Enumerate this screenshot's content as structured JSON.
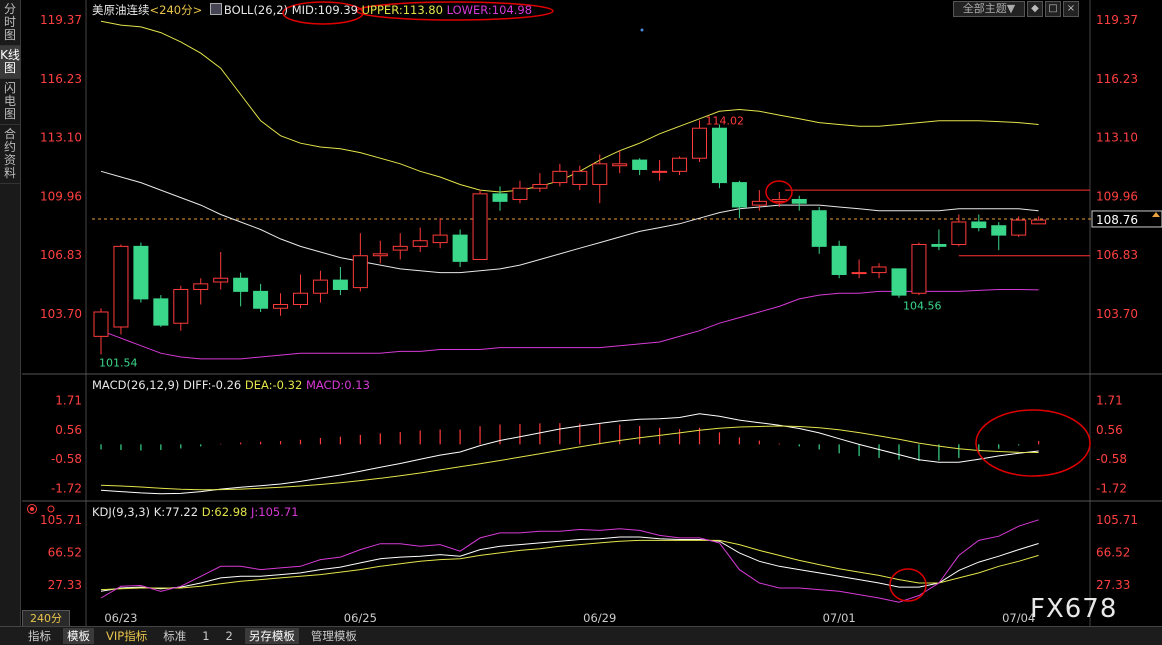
{
  "sidebar": {
    "items": [
      {
        "label": "分时图",
        "active": false
      },
      {
        "label": "K线图",
        "active": true
      },
      {
        "label": "闪电图",
        "active": false
      },
      {
        "label": "合约资料",
        "active": false
      }
    ]
  },
  "header": {
    "instrument": "美原油连续",
    "period": "<240分>",
    "indicator_name": "BOLL(26,2)",
    "mid": "MID:109.39",
    "upper": "UPPER:113.80",
    "lower": "LOWER:104.98",
    "theme_button": "全部主题▼",
    "win_buttons": [
      "◆",
      "□",
      "×"
    ]
  },
  "macd_header": {
    "name": "MACD(26,12,9)",
    "diff": "DIFF:-0.26",
    "dea": "DEA:-0.32",
    "macd": "MACD:0.13"
  },
  "kdj_header": {
    "name": "KDJ(9,3,3)",
    "k": "K:77.22",
    "d": "D:62.98",
    "j": "J:105.71"
  },
  "price_axis": [
    "119.37",
    "116.23",
    "113.10",
    "109.96",
    "106.83",
    "103.70"
  ],
  "macd_axis": [
    "1.71",
    "0.56",
    "-0.58",
    "-1.72"
  ],
  "kdj_axis": [
    "105.71",
    "66.52",
    "27.33"
  ],
  "current_price": "108.76",
  "annotations": {
    "high": "114.02",
    "low_left": "101.54",
    "low_right": "104.56"
  },
  "date_labels": [
    "06/23",
    "06/25",
    "06/29",
    "07/01",
    "07/04"
  ],
  "period_box": "240分",
  "bottom_tabs": [
    {
      "label": "指标",
      "style": "normal"
    },
    {
      "label": "模板",
      "style": "active"
    },
    {
      "label": "VIP指标",
      "style": "vip"
    },
    {
      "label": "标准",
      "style": "normal"
    },
    {
      "label": "1",
      "style": "normal"
    },
    {
      "label": "2",
      "style": "normal"
    },
    {
      "label": "另存模板",
      "style": "active"
    },
    {
      "label": "管理模板",
      "style": "normal"
    }
  ],
  "watermark": "FX678",
  "colors": {
    "up": "#ff3b3b",
    "down": "#3ad68a",
    "upper_band": "#e3e34a",
    "mid_band": "#e8e8e8",
    "lower_band": "#d63ad6",
    "axis_text": "#ff4040",
    "dea": "#e3e34a",
    "diff": "#ffffff",
    "j_line": "#d63ad6",
    "annotation_circle": "#e00000"
  },
  "chart_data": {
    "type": "candlestick",
    "period": "240分",
    "candles": [
      {
        "o": 102.5,
        "c": 103.8,
        "h": 104.0,
        "l": 101.54
      },
      {
        "o": 103.0,
        "c": 107.3,
        "h": 107.4,
        "l": 102.6
      },
      {
        "o": 107.3,
        "c": 104.5,
        "h": 107.5,
        "l": 104.3
      },
      {
        "o": 104.5,
        "c": 103.1,
        "h": 104.7,
        "l": 103.0
      },
      {
        "o": 103.2,
        "c": 105.0,
        "h": 105.2,
        "l": 102.8
      },
      {
        "o": 105.0,
        "c": 105.3,
        "h": 105.6,
        "l": 104.2
      },
      {
        "o": 105.4,
        "c": 105.6,
        "h": 107.0,
        "l": 105.0
      },
      {
        "o": 105.6,
        "c": 104.9,
        "h": 105.9,
        "l": 104.1
      },
      {
        "o": 104.9,
        "c": 104.0,
        "h": 105.3,
        "l": 103.8
      },
      {
        "o": 104.0,
        "c": 104.2,
        "h": 104.8,
        "l": 103.6
      },
      {
        "o": 104.2,
        "c": 104.8,
        "h": 105.8,
        "l": 104.0
      },
      {
        "o": 104.8,
        "c": 105.5,
        "h": 106.0,
        "l": 104.3
      },
      {
        "o": 105.5,
        "c": 105.0,
        "h": 106.2,
        "l": 104.7
      },
      {
        "o": 105.1,
        "c": 106.8,
        "h": 108.0,
        "l": 104.9
      },
      {
        "o": 106.8,
        "c": 106.9,
        "h": 107.6,
        "l": 106.4
      },
      {
        "o": 107.1,
        "c": 107.3,
        "h": 108.0,
        "l": 106.6
      },
      {
        "o": 107.3,
        "c": 107.6,
        "h": 108.3,
        "l": 107.0
      },
      {
        "o": 107.5,
        "c": 107.9,
        "h": 108.8,
        "l": 107.2
      },
      {
        "o": 107.9,
        "c": 106.5,
        "h": 108.2,
        "l": 106.2
      },
      {
        "o": 106.6,
        "c": 110.1,
        "h": 110.3,
        "l": 106.6
      },
      {
        "o": 110.1,
        "c": 109.7,
        "h": 110.5,
        "l": 109.2
      },
      {
        "o": 109.8,
        "c": 110.4,
        "h": 110.8,
        "l": 109.6
      },
      {
        "o": 110.4,
        "c": 110.6,
        "h": 111.2,
        "l": 110.2
      },
      {
        "o": 110.7,
        "c": 111.3,
        "h": 111.7,
        "l": 110.5
      },
      {
        "o": 110.6,
        "c": 111.3,
        "h": 111.6,
        "l": 110.3
      },
      {
        "o": 110.6,
        "c": 111.7,
        "h": 112.2,
        "l": 109.6
      },
      {
        "o": 111.6,
        "c": 111.7,
        "h": 112.4,
        "l": 111.2
      },
      {
        "o": 111.9,
        "c": 111.4,
        "h": 112.0,
        "l": 111.1
      },
      {
        "o": 111.3,
        "c": 111.3,
        "h": 111.9,
        "l": 110.8
      },
      {
        "o": 111.3,
        "c": 112.0,
        "h": 112.1,
        "l": 111.1
      },
      {
        "o": 112.0,
        "c": 113.6,
        "h": 114.02,
        "l": 111.8
      },
      {
        "o": 113.6,
        "c": 110.7,
        "h": 113.8,
        "l": 110.4
      },
      {
        "o": 110.7,
        "c": 109.4,
        "h": 110.8,
        "l": 108.8
      },
      {
        "o": 109.5,
        "c": 109.7,
        "h": 110.3,
        "l": 109.2
      },
      {
        "o": 109.7,
        "c": 109.8,
        "h": 110.2,
        "l": 109.4
      },
      {
        "o": 109.8,
        "c": 109.6,
        "h": 110.0,
        "l": 109.2
      },
      {
        "o": 109.2,
        "c": 107.3,
        "h": 109.4,
        "l": 106.9
      },
      {
        "o": 107.3,
        "c": 105.8,
        "h": 107.6,
        "l": 105.6
      },
      {
        "o": 105.9,
        "c": 105.9,
        "h": 106.6,
        "l": 105.6
      },
      {
        "o": 105.9,
        "c": 106.2,
        "h": 106.4,
        "l": 105.6
      },
      {
        "o": 106.1,
        "c": 104.7,
        "h": 106.1,
        "l": 104.56
      },
      {
        "o": 104.8,
        "c": 107.4,
        "h": 107.5,
        "l": 104.7
      },
      {
        "o": 107.4,
        "c": 107.3,
        "h": 108.2,
        "l": 107.1
      },
      {
        "o": 107.4,
        "c": 108.6,
        "h": 109.0,
        "l": 107.3
      },
      {
        "o": 108.6,
        "c": 108.3,
        "h": 109.0,
        "l": 108.1
      },
      {
        "o": 108.4,
        "c": 107.9,
        "h": 108.6,
        "l": 107.1
      },
      {
        "o": 107.9,
        "c": 108.7,
        "h": 108.9,
        "l": 107.8
      },
      {
        "o": 108.5,
        "c": 108.7,
        "h": 108.9,
        "l": 108.5
      }
    ],
    "boll_upper": [
      119.3,
      119.1,
      119.0,
      118.7,
      118.2,
      117.6,
      116.8,
      115.4,
      114.0,
      113.2,
      112.8,
      112.6,
      112.5,
      112.3,
      112.0,
      111.7,
      111.3,
      111.0,
      110.6,
      110.3,
      110.2,
      110.3,
      110.5,
      110.8,
      111.3,
      111.9,
      112.4,
      112.8,
      113.3,
      113.7,
      114.1,
      114.5,
      114.6,
      114.5,
      114.3,
      114.1,
      113.9,
      113.8,
      113.7,
      113.7,
      113.8,
      113.9,
      114.0,
      114.0,
      114.0,
      113.95,
      113.9,
      113.8
    ],
    "boll_mid": [
      111.3,
      111.0,
      110.7,
      110.3,
      109.9,
      109.5,
      109.0,
      108.6,
      108.2,
      107.7,
      107.3,
      107.0,
      106.7,
      106.5,
      106.3,
      106.1,
      106.0,
      105.9,
      105.9,
      106.0,
      106.1,
      106.3,
      106.6,
      106.9,
      107.2,
      107.5,
      107.8,
      108.1,
      108.3,
      108.5,
      108.8,
      109.1,
      109.3,
      109.4,
      109.5,
      109.5,
      109.5,
      109.4,
      109.3,
      109.2,
      109.2,
      109.2,
      109.2,
      109.3,
      109.3,
      109.3,
      109.3,
      109.2
    ],
    "boll_lower": [
      102.8,
      102.4,
      102.0,
      101.6,
      101.4,
      101.3,
      101.3,
      101.3,
      101.4,
      101.5,
      101.6,
      101.6,
      101.6,
      101.6,
      101.6,
      101.7,
      101.7,
      101.8,
      101.8,
      101.8,
      101.9,
      101.9,
      101.9,
      101.9,
      101.9,
      101.9,
      102.0,
      102.1,
      102.2,
      102.5,
      102.8,
      103.2,
      103.5,
      103.8,
      104.1,
      104.5,
      104.7,
      104.8,
      104.8,
      104.9,
      104.9,
      104.9,
      104.9,
      104.9,
      104.95,
      105.0,
      105.0,
      104.98
    ],
    "macd_diff": [
      -1.8,
      -1.85,
      -1.9,
      -1.93,
      -1.92,
      -1.85,
      -1.75,
      -1.68,
      -1.62,
      -1.55,
      -1.45,
      -1.32,
      -1.2,
      -1.05,
      -0.9,
      -0.75,
      -0.58,
      -0.42,
      -0.3,
      -0.05,
      0.15,
      0.3,
      0.45,
      0.6,
      0.72,
      0.82,
      0.92,
      0.98,
      1.0,
      1.05,
      1.2,
      1.1,
      0.95,
      0.85,
      0.75,
      0.62,
      0.45,
      0.22,
      0.0,
      -0.2,
      -0.4,
      -0.6,
      -0.7,
      -0.7,
      -0.58,
      -0.45,
      -0.35,
      -0.26
    ],
    "macd_dea": [
      -1.6,
      -1.63,
      -1.67,
      -1.72,
      -1.76,
      -1.78,
      -1.77,
      -1.75,
      -1.72,
      -1.68,
      -1.63,
      -1.57,
      -1.5,
      -1.42,
      -1.33,
      -1.23,
      -1.12,
      -1.0,
      -0.88,
      -0.76,
      -0.63,
      -0.5,
      -0.37,
      -0.23,
      -0.1,
      0.03,
      0.15,
      0.26,
      0.35,
      0.45,
      0.55,
      0.63,
      0.68,
      0.7,
      0.72,
      0.7,
      0.65,
      0.57,
      0.46,
      0.33,
      0.2,
      0.05,
      -0.07,
      -0.17,
      -0.24,
      -0.28,
      -0.31,
      -0.32
    ],
    "macd_hist": [
      -0.2,
      -0.22,
      -0.24,
      -0.22,
      -0.16,
      -0.08,
      0.02,
      0.07,
      0.1,
      0.13,
      0.18,
      0.25,
      0.3,
      0.37,
      0.43,
      0.48,
      0.54,
      0.58,
      0.58,
      0.71,
      0.78,
      0.8,
      0.82,
      0.83,
      0.82,
      0.79,
      0.77,
      0.72,
      0.65,
      0.6,
      0.65,
      0.47,
      0.27,
      0.15,
      0.03,
      -0.08,
      -0.2,
      -0.35,
      -0.46,
      -0.53,
      -0.6,
      -0.65,
      -0.63,
      -0.53,
      -0.34,
      -0.17,
      -0.04,
      0.13
    ],
    "kdj_k": [
      20,
      24,
      25,
      23,
      25,
      30,
      36,
      38,
      38,
      40,
      42,
      46,
      49,
      54,
      59,
      61,
      62,
      64,
      62,
      70,
      74,
      76,
      78,
      80,
      82,
      83,
      85,
      85,
      83,
      82,
      82,
      80,
      66,
      56,
      50,
      46,
      42,
      38,
      34,
      30,
      25,
      25,
      30,
      45,
      55,
      62,
      70,
      77.22
    ],
    "kdj_d": [
      22,
      23,
      24,
      24,
      24,
      26,
      29,
      32,
      34,
      36,
      38,
      40,
      43,
      46,
      50,
      53,
      56,
      58,
      59,
      63,
      66,
      69,
      71,
      74,
      76,
      78,
      80,
      81,
      81,
      81,
      81,
      81,
      76,
      69,
      63,
      57,
      52,
      47,
      43,
      39,
      34,
      30,
      30,
      36,
      42,
      50,
      56,
      62.98
    ],
    "kdj_j": [
      12,
      26,
      27,
      20,
      26,
      38,
      50,
      50,
      46,
      48,
      50,
      58,
      61,
      70,
      77,
      77,
      74,
      76,
      68,
      84,
      90,
      90,
      92,
      92,
      94,
      93,
      95,
      93,
      87,
      84,
      84,
      78,
      46,
      30,
      24,
      24,
      22,
      20,
      16,
      12,
      7,
      15,
      30,
      63,
      81,
      86,
      98,
      105.71
    ],
    "price_axis_ticks": [
      119.37,
      116.23,
      113.1,
      109.96,
      106.83,
      103.7
    ],
    "macd_axis_ticks": [
      1.71,
      0.56,
      -0.58,
      -1.72
    ],
    "kdj_axis_ticks": [
      105.71,
      66.52,
      27.33
    ],
    "reference_lines": {
      "resistance": 110.3,
      "support": 106.8,
      "current": 108.76
    }
  }
}
